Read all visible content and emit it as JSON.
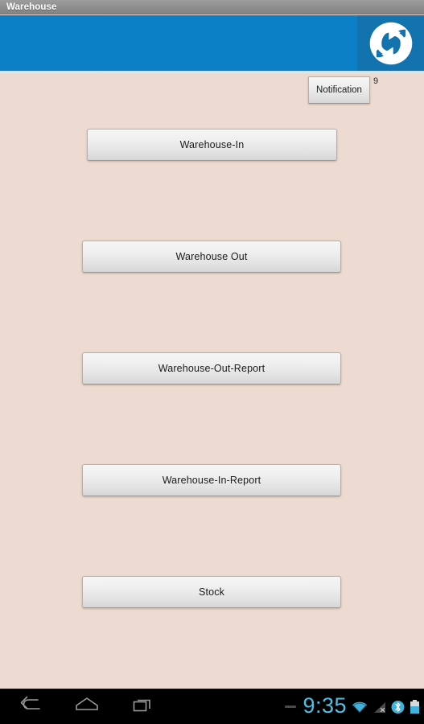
{
  "window": {
    "title": "Warehouse"
  },
  "header": {
    "logo_icon": "sync-circle-logo",
    "background_color": "#0b80c6",
    "logo_block_color": "#1273af"
  },
  "notification": {
    "label": "Notification",
    "badge_count": "9"
  },
  "menu": {
    "buttons": [
      {
        "label": "Warehouse-In",
        "name": "warehouse-in-button"
      },
      {
        "label": "Warehouse Out",
        "name": "warehouse-out-button"
      },
      {
        "label": "Warehouse-Out-Report",
        "name": "warehouse-out-report-button"
      },
      {
        "label": "Warehouse-In-Report",
        "name": "warehouse-in-report-button"
      },
      {
        "label": "Stock",
        "name": "stock-button"
      }
    ]
  },
  "navbar": {
    "back_icon": "back-arrow-icon",
    "home_icon": "home-icon",
    "recents_icon": "recent-apps-icon"
  },
  "statusbar": {
    "clock": "9:35",
    "clock_color": "#4fbfe6",
    "icons": [
      "wifi-icon",
      "cellular-signal-off-icon",
      "bluetooth-icon",
      "battery-icon"
    ]
  },
  "theme": {
    "page_background": "#EDDAD0",
    "accent": "#0b80c6"
  }
}
